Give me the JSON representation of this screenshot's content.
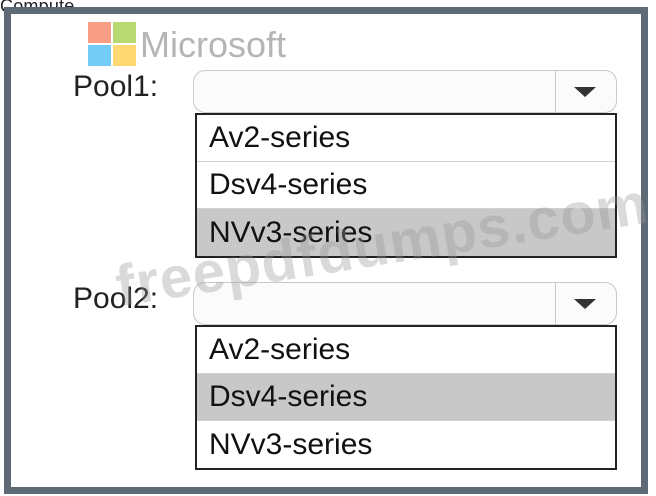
{
  "header": {
    "partial_top_text": "Compute"
  },
  "branding": {
    "logo_text": "Microsoft",
    "logo_colors": [
      "#f25022",
      "#7fba00",
      "#00a4ef",
      "#ffb900"
    ],
    "watermark_site": "freepdfdumps.com"
  },
  "pool1": {
    "label": "Pool1:",
    "value": "",
    "options": [
      {
        "label": "Av2-series",
        "selected": false
      },
      {
        "label": "Dsv4-series",
        "selected": false
      },
      {
        "label": "NVv3-series",
        "selected": true
      }
    ]
  },
  "pool2": {
    "label": "Pool2:",
    "value": "",
    "options": [
      {
        "label": "Av2-series",
        "selected": false
      },
      {
        "label": "Dsv4-series",
        "selected": true
      },
      {
        "label": "NVv3-series",
        "selected": false
      }
    ]
  },
  "colors": {
    "frame_border": "#5f6a77",
    "selected_option_bg": "#c8c8c8"
  },
  "icons": {
    "dropdown_arrow": "chevron-down-icon"
  }
}
